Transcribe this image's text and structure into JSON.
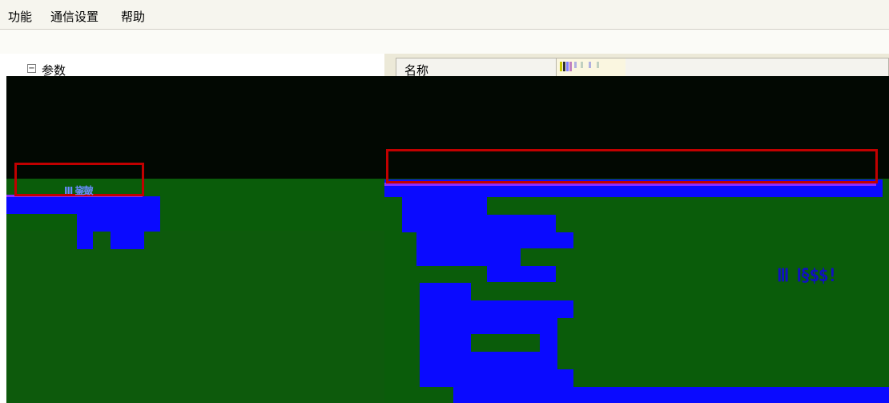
{
  "menubar": {
    "items": [
      "功能",
      "通信设置",
      "帮助"
    ]
  },
  "tree": {
    "expander": "−",
    "root_label": "参数"
  },
  "grid": {
    "col_name_header": "名称"
  },
  "overlay": {
    "left_caption": "Ⅲ 鋆皷",
    "right_status": "ⅡⅠ Ⅰ§$$!"
  },
  "colors": {
    "selection_red": "#c10000",
    "highlight_blue": "#0a0aff",
    "panel_green": "#0a5c0a",
    "panel_dark": "#020802"
  }
}
